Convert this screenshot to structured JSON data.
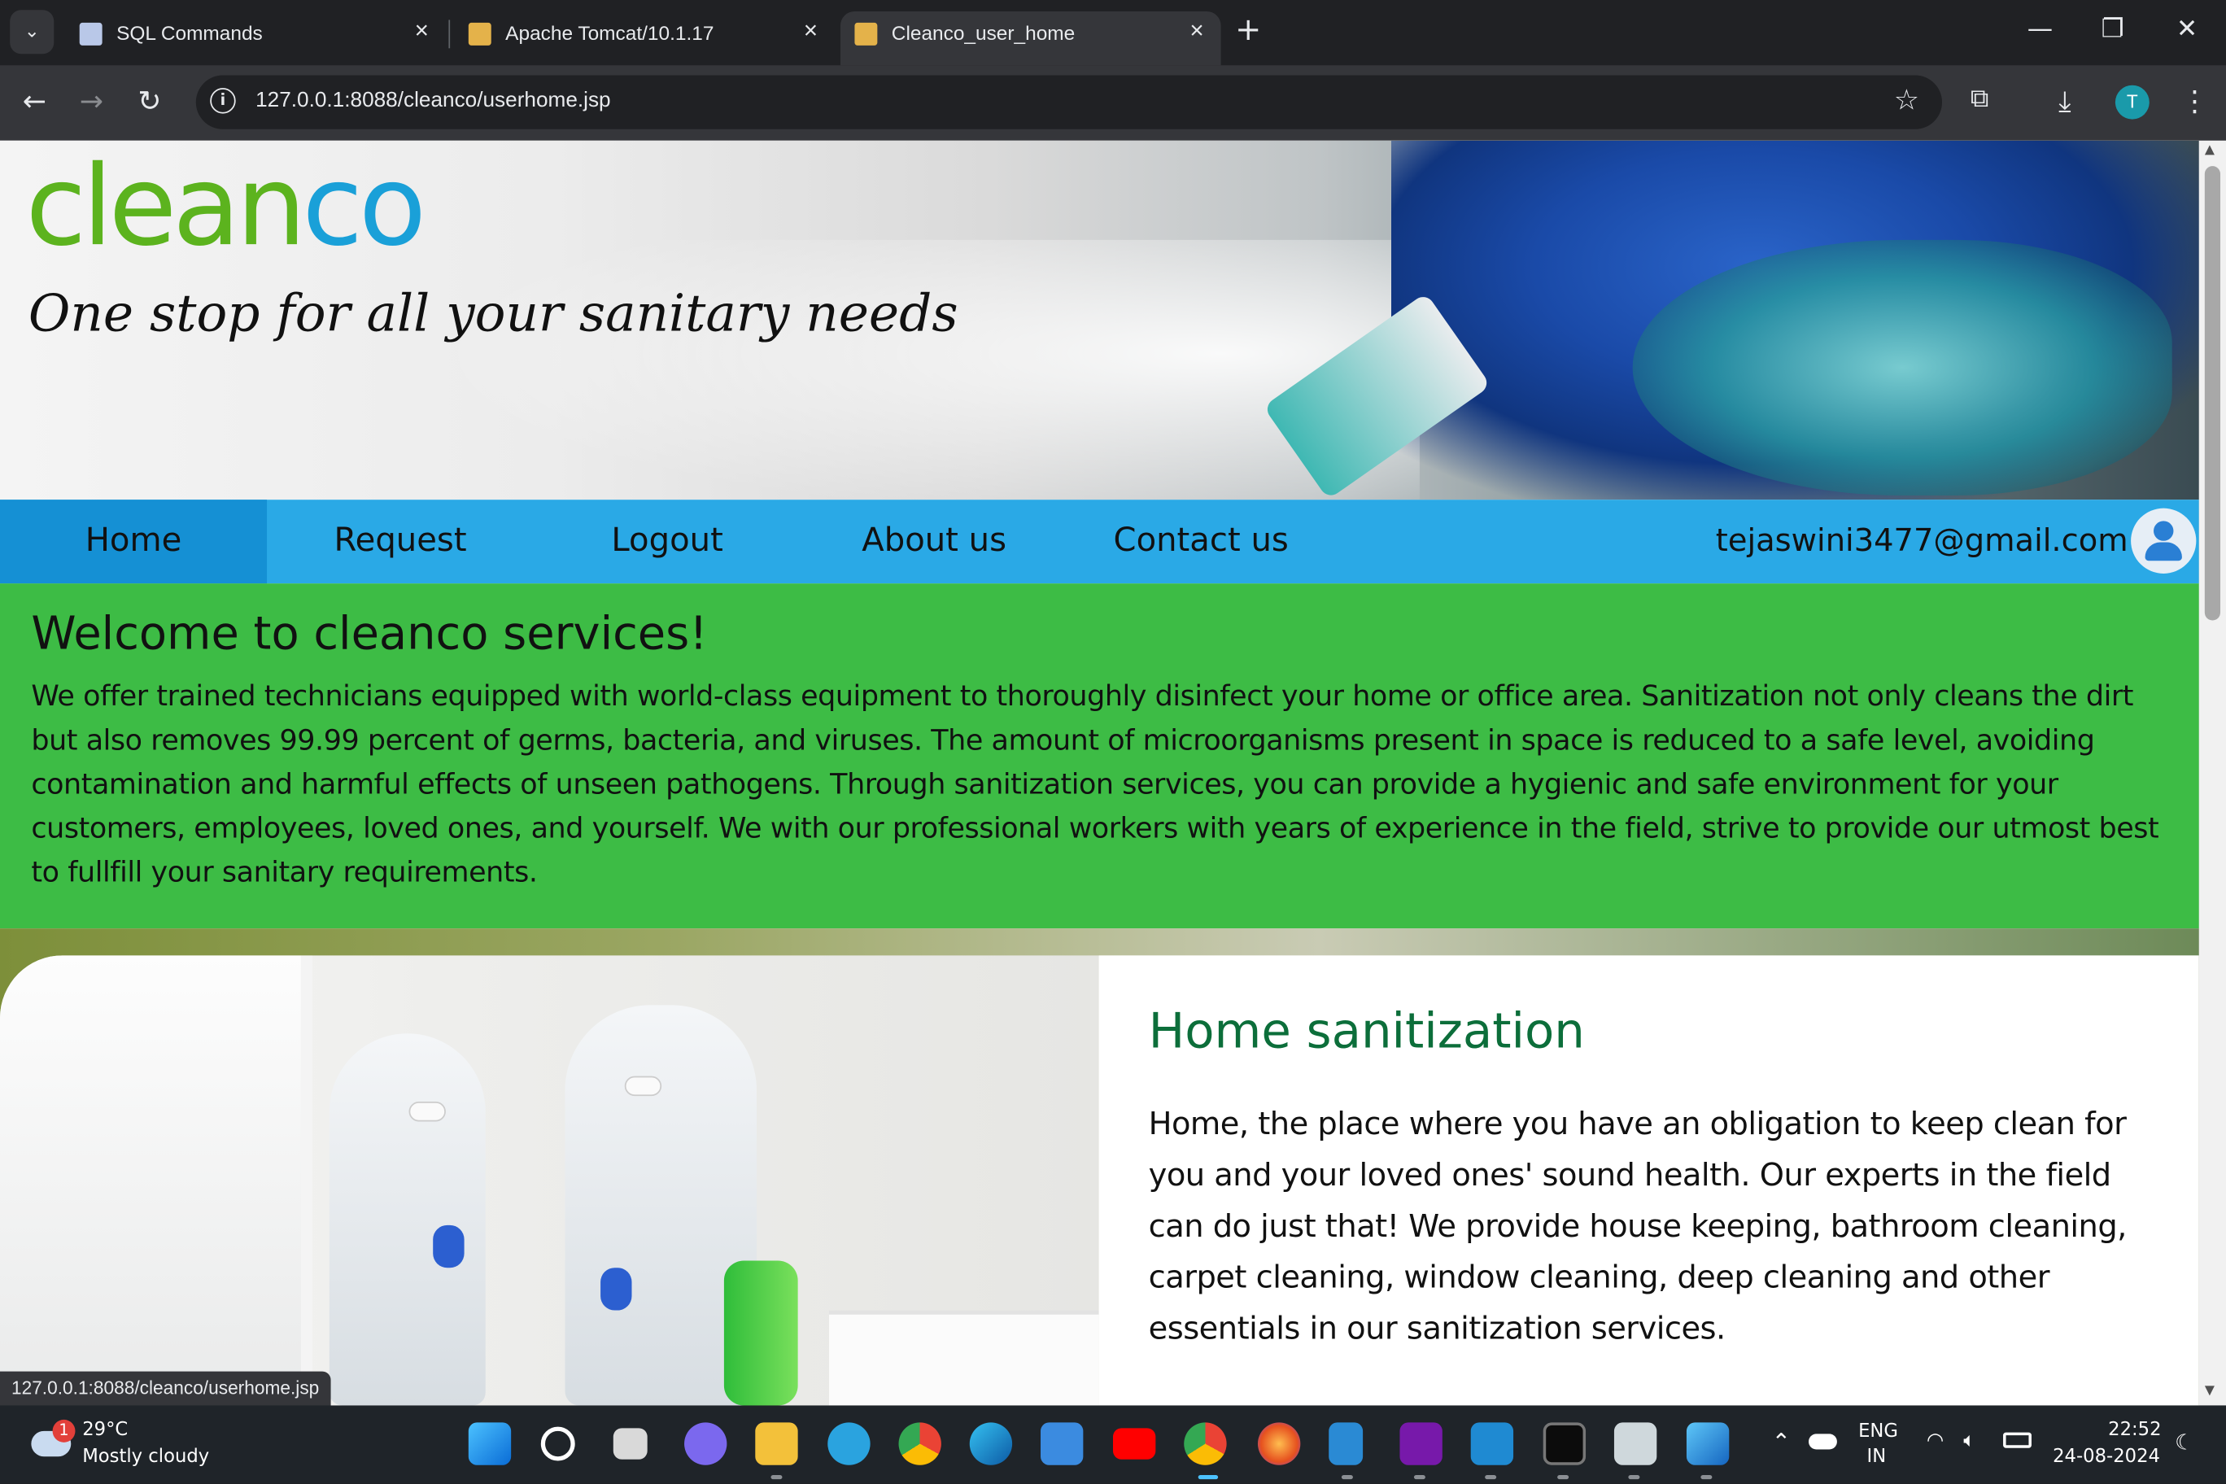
{
  "browser": {
    "tabs": [
      {
        "title": "SQL Commands",
        "favicon_color": "#b9c8e8",
        "active": false
      },
      {
        "title": "Apache Tomcat/10.1.17",
        "favicon_color": "#e4b24a",
        "active": false
      },
      {
        "title": "Cleanco_user_home",
        "favicon_color": "#e4b24a",
        "active": true
      }
    ],
    "new_tab_icon": "+",
    "url": "127.0.0.1:8088/cleanco/userhome.jsp",
    "profile_initial": "T",
    "status_url": "127.0.0.1:8088/cleanco/userhome.jsp"
  },
  "site": {
    "logo": {
      "part1": "clean",
      "part2": "co",
      "color1": "#5cb31e",
      "color2": "#1aa0d8"
    },
    "tagline": "One stop for all your sanitary needs",
    "nav": {
      "items": [
        "Home",
        "Request",
        "Logout",
        "About us",
        "Contact us"
      ],
      "active": "Home",
      "user_email": "tejaswini3477@gmail.com"
    },
    "welcome": {
      "heading": "Welcome to cleanco services!",
      "body": "We offer trained technicians equipped with world-class equipment to thoroughly disinfect your home or office area. Sanitization not only cleans the dirt but also removes 99.99 percent of germs, bacteria, and viruses. The amount of microorganisms present in space is reduced to a safe level, avoiding contamination and harmful effects of unseen pathogens. Through sanitization services, you can provide a hygienic and safe environment for your customers, employees, loved ones, and yourself. We with our professional workers with years of experience in the field, strive to provide our utmost best to fullfill your sanitary requirements."
    },
    "service": {
      "title": "Home sanitization",
      "body": "Home, the place where you have an obligation to keep clean for you and your loved ones' sound health. Our experts in the field can do just that! We provide house keeping, bathroom cleaning, carpet cleaning, window cleaning, deep cleaning and other essentials in our sanitization services."
    },
    "colors": {
      "nav": "#2aa9e6",
      "nav_active": "#1590d4",
      "welcome_bg": "#3dbc45",
      "service_title": "#0c6e3a"
    }
  },
  "taskbar": {
    "weather": {
      "badge": "1",
      "temp": "29°C",
      "condition": "Mostly cloudy"
    },
    "apps": [
      "start",
      "search",
      "task-view",
      "meet",
      "file-explorer",
      "telegram",
      "chrome-profile",
      "edge",
      "mail",
      "youtube",
      "chrome",
      "firefox",
      "notepad",
      "onenote",
      "vscode",
      "terminal",
      "app",
      "photos"
    ],
    "tray": {
      "lang1": "ENG",
      "lang2": "IN",
      "time": "22:52",
      "date": "24-08-2024"
    }
  }
}
